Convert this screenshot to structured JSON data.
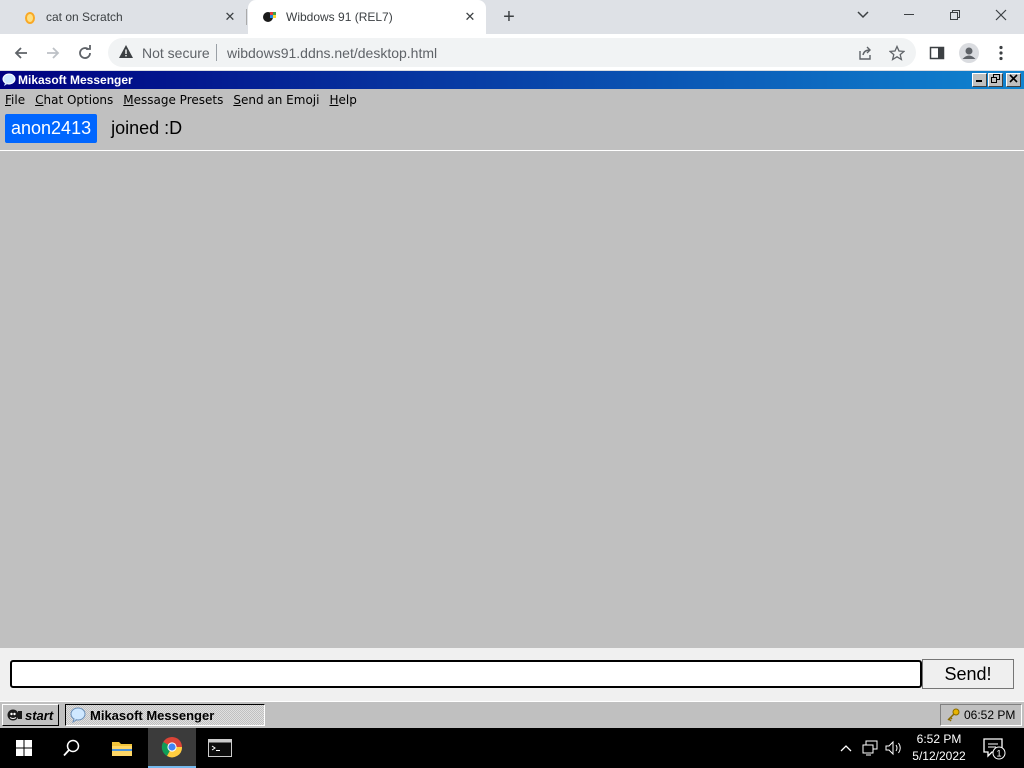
{
  "browser": {
    "tabs": [
      {
        "title": "cat on Scratch",
        "active": false,
        "icon": "scratch-cat-icon"
      },
      {
        "title": "Wibdows 91 (REL7)",
        "active": true,
        "icon": "wibdows-logo-icon"
      }
    ],
    "security_label": "Not secure",
    "url": "wibdows91.ddns.net/desktop.html"
  },
  "window": {
    "title": "Mikasoft Messenger",
    "menu": [
      "File",
      "Chat Options",
      "Message Presets",
      "Send an Emoji",
      "Help"
    ],
    "menu_access_keys": [
      "F",
      "C",
      "M",
      "S",
      "H"
    ]
  },
  "chat": {
    "messages": [
      {
        "user": "anon2413",
        "text": "joined :D"
      }
    ],
    "user_badge_color": "#0066ff"
  },
  "composer": {
    "value": "",
    "send_label": "Send!"
  },
  "wibdows_taskbar": {
    "start_label": "start",
    "task_label": "Mikasoft Messenger",
    "tray_time": "06:52 PM"
  },
  "os_taskbar": {
    "time": "6:52 PM",
    "date": "5/12/2022",
    "notification_count": "1"
  }
}
